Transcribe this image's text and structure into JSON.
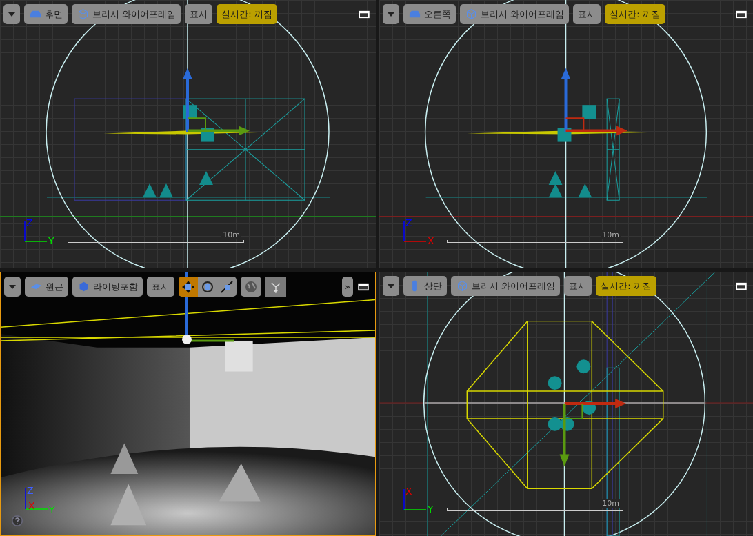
{
  "viewports": [
    {
      "kind": "back",
      "selected": false,
      "view": "후면",
      "view_mode": "브러시 와이어프레임",
      "show": "표시",
      "realtime": "실시간: 꺼짐",
      "scale_label": "10m",
      "axes": [
        {
          "label": "Z",
          "color": "#0000ff"
        },
        {
          "label": "Y",
          "color": "#00e000"
        }
      ]
    },
    {
      "kind": "right",
      "selected": false,
      "view": "오른쪽",
      "view_mode": "브러시 와이어프레임",
      "show": "표시",
      "realtime": "실시간: 꺼짐",
      "scale_label": "10m",
      "axes": [
        {
          "label": "Z",
          "color": "#0000ff"
        },
        {
          "label": "X",
          "color": "#e00000"
        }
      ]
    },
    {
      "kind": "perspective",
      "selected": true,
      "view": "원근",
      "view_mode": "라이팅포함",
      "show": "표시",
      "more": "»",
      "tools": [
        {
          "kind": "move",
          "selected": true
        },
        {
          "kind": "rotate",
          "selected": false
        },
        {
          "kind": "scale",
          "selected": false
        }
      ],
      "axes": [
        {
          "label": "Z",
          "color": "#4060ff"
        },
        {
          "label": "X",
          "color": "#e00000"
        },
        {
          "label": "Y",
          "color": "#00e000"
        }
      ]
    },
    {
      "kind": "top",
      "selected": false,
      "view": "상단",
      "view_mode": "브러시 와이어프레임",
      "show": "표시",
      "realtime": "실시간: 꺼짐",
      "scale_label": "10m",
      "axes": [
        {
          "label": "X",
          "color": "#e00000"
        },
        {
          "label": "Y",
          "color": "#00e000"
        }
      ]
    }
  ]
}
